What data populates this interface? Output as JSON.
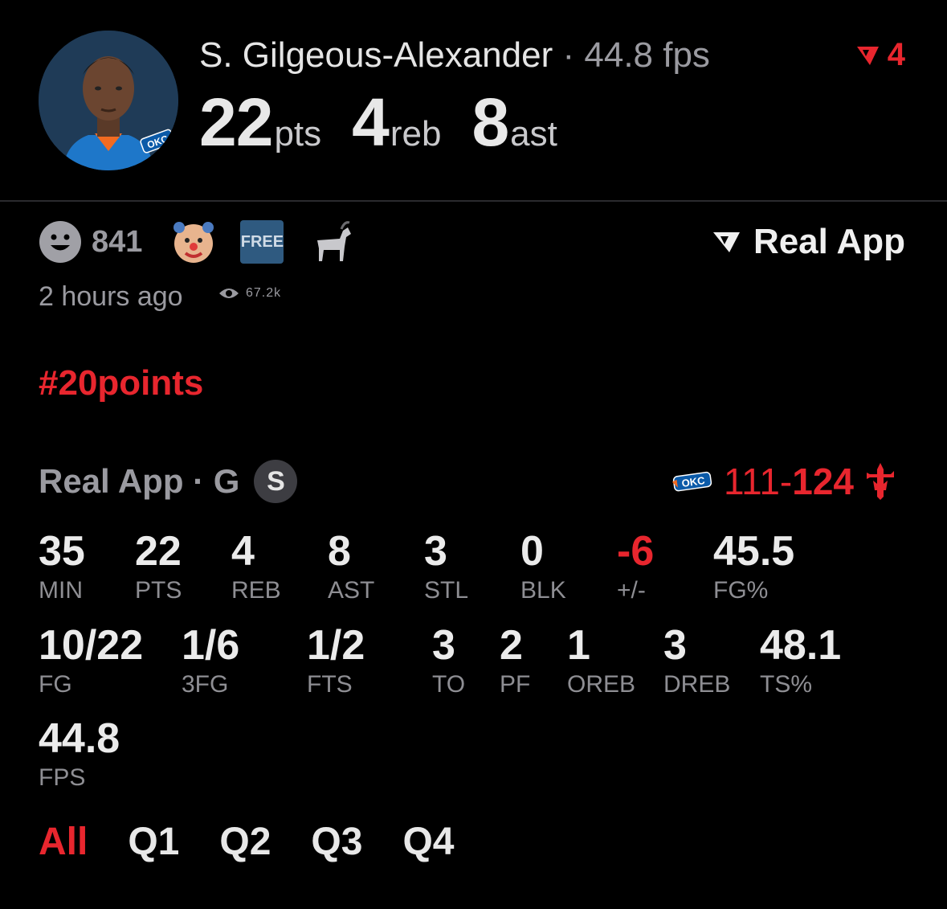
{
  "player": {
    "name": "S. Gilgeous-Alexander",
    "separator": "·",
    "fps_header": "44.8 fps",
    "notif_count": "4",
    "pts": "22",
    "pts_unit": "pts",
    "reb": "4",
    "reb_unit": "reb",
    "ast": "8",
    "ast_unit": "ast",
    "team_logo_text": "OKC"
  },
  "reactions": {
    "smile_count": "841",
    "free_label": "FREE",
    "brand": "Real App"
  },
  "meta": {
    "time_ago": "2 hours ago",
    "views": "67.2k"
  },
  "hashtag": "#20points",
  "game": {
    "label": "Real App · G",
    "badge": "S",
    "score_away": "111-",
    "score_home": "124",
    "away_logo_text": "OKC"
  },
  "stats_row1": [
    {
      "value": "35",
      "label": "MIN"
    },
    {
      "value": "22",
      "label": "PTS"
    },
    {
      "value": "4",
      "label": "REB"
    },
    {
      "value": "8",
      "label": "AST"
    },
    {
      "value": "3",
      "label": "STL"
    },
    {
      "value": "0",
      "label": "BLK"
    },
    {
      "value": "-6",
      "label": "+/-"
    },
    {
      "value": "45.5",
      "label": "FG%"
    }
  ],
  "stats_row2": [
    {
      "value": "10/22",
      "label": "FG"
    },
    {
      "value": "1/6",
      "label": "3FG"
    },
    {
      "value": "1/2",
      "label": "FTS"
    },
    {
      "value": "3",
      "label": "TO"
    },
    {
      "value": "2",
      "label": "PF"
    },
    {
      "value": "1",
      "label": "OREB"
    },
    {
      "value": "3",
      "label": "DREB"
    },
    {
      "value": "48.1",
      "label": "TS%"
    }
  ],
  "stats_row3": [
    {
      "value": "44.8",
      "label": "FPS"
    }
  ],
  "quarters": [
    "All",
    "Q1",
    "Q2",
    "Q3",
    "Q4"
  ],
  "colors": {
    "accent": "#e8262e",
    "background": "#000000",
    "muted": "#9a9aa0"
  }
}
